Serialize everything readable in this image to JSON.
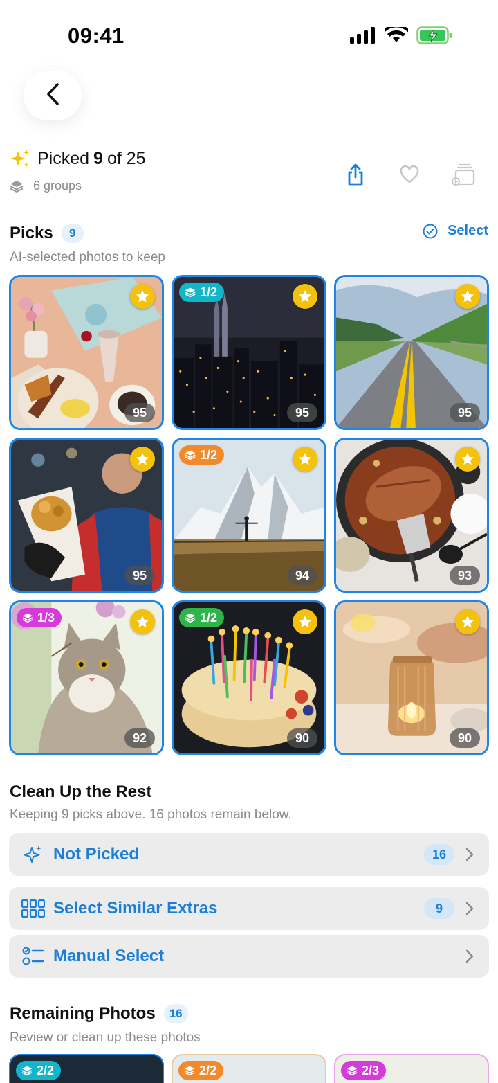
{
  "status": {
    "time": "09:41"
  },
  "summary": {
    "prefix": "Picked",
    "picked": "9",
    "of_text": "of 25",
    "groups_text": "6 groups"
  },
  "picks": {
    "title": "Picks",
    "count": "9",
    "subtitle": "AI-selected photos to keep",
    "select_label": "Select",
    "tiles": [
      {
        "score": "95",
        "badge": "",
        "scene": "breakfast table"
      },
      {
        "score": "95",
        "badge": "1/2",
        "badge_color": "#12b5c9",
        "scene": "city at night"
      },
      {
        "score": "95",
        "badge": "",
        "scene": "road in mountains"
      },
      {
        "score": "95",
        "badge": "",
        "scene": "man holding pastry"
      },
      {
        "score": "94",
        "badge": "1/2",
        "badge_color": "#f08a2c",
        "scene": "snowy mountain"
      },
      {
        "score": "93",
        "badge": "",
        "scene": "fish in pan"
      },
      {
        "score": "92",
        "badge": "1/3",
        "badge_color": "#d63ad8",
        "scene": "cat"
      },
      {
        "score": "90",
        "badge": "1/2",
        "badge_color": "#2fb44a",
        "scene": "birthday cake"
      },
      {
        "score": "90",
        "badge": "",
        "scene": "candle jar"
      }
    ]
  },
  "cleanup": {
    "title": "Clean Up the Rest",
    "subtitle": "Keeping 9 picks above. 16 photos remain below.",
    "rows": [
      {
        "label": "Not Picked",
        "count": "16",
        "icon": "sparkle-icon"
      },
      {
        "label": "Select Similar Extras",
        "count": "9",
        "icon": "grid-icon"
      },
      {
        "label": "Manual Select",
        "count": "",
        "icon": "checklist-icon"
      }
    ]
  },
  "remaining": {
    "title": "Remaining Photos",
    "count": "16",
    "subtitle": "Review or clean up these photos",
    "tiles": [
      {
        "badge": "2/2",
        "badge_color": "#12b5c9"
      },
      {
        "badge": "2/2",
        "badge_color": "#f08a2c"
      },
      {
        "badge": "2/3",
        "badge_color": "#d63ad8"
      }
    ]
  },
  "colors": {
    "accent": "#1a7fd8",
    "tile_border": "#1f86e6",
    "star": "#f4c20d"
  }
}
